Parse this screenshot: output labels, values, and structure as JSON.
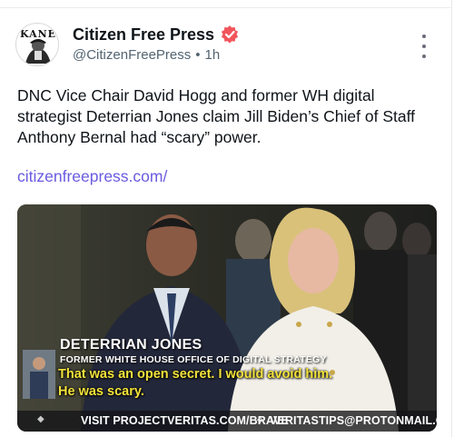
{
  "post": {
    "display_name": "Citizen Free Press",
    "handle": "@CitizenFreePress",
    "separator": "•",
    "timestamp": "1h",
    "avatar_text": "KANE",
    "text": "DNC Vice Chair David Hogg and former WH digital strategist Deterrian Jones claim Jill Biden’s Chief of Staff Anthony Bernal had “scary” power.",
    "link": "citizenfreepress.com/",
    "icons": {
      "verified": "verified-badge-icon",
      "more": "more-vertical-icon"
    },
    "colors": {
      "verified_badge": "#f2545b",
      "link": "#6a5ae0"
    }
  },
  "media": {
    "lower_third_name": "DETERRIAN JONES",
    "lower_third_title": "FORMER WHITE HOUSE OFFICE OF DIGITAL STRATEGY",
    "caption_line1": "That was an open secret. I would avoid him.",
    "caption_line2": "He was scary.",
    "promo_left": "VISIT PROJECTVERITAS.COM/BRAVE",
    "promo_separator": "✧",
    "promo_right": "VERITASTIPS@PROTONMAIL.COM",
    "caption_color": "#f2e23a"
  }
}
